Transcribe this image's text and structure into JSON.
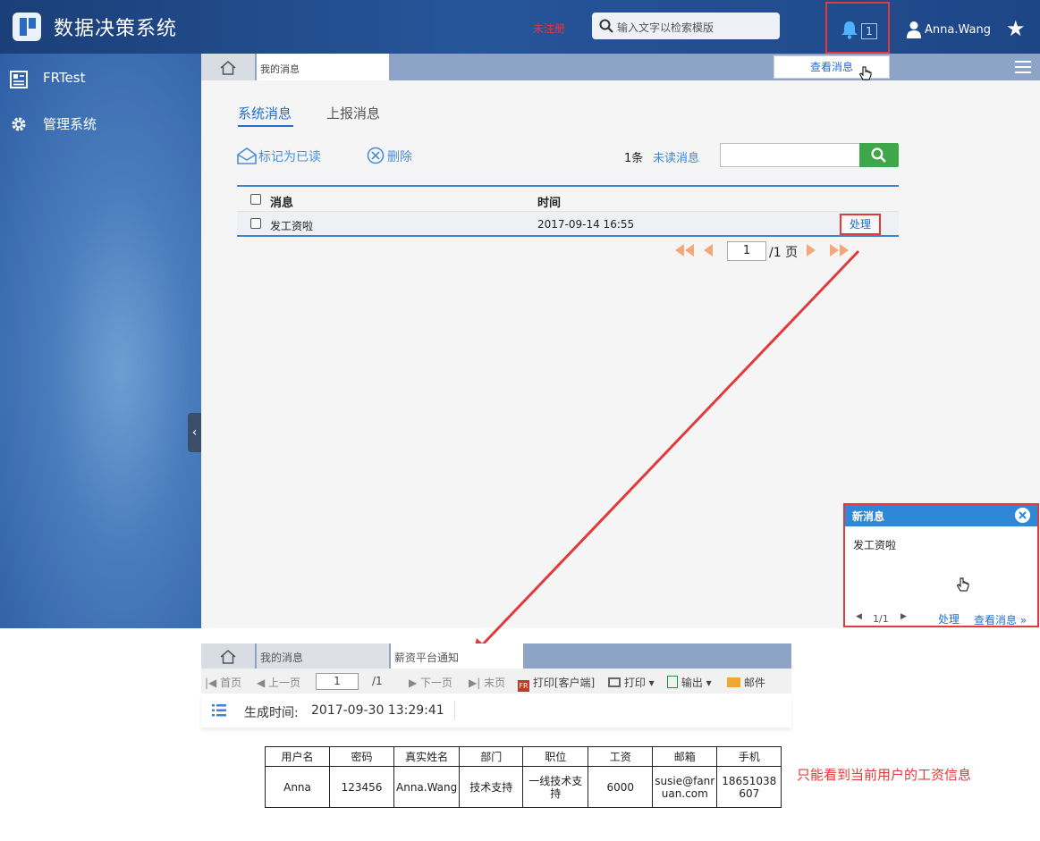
{
  "header": {
    "title": "数据决策系统",
    "unregistered": "未注册",
    "search_placeholder": "输入文字以检索模版",
    "notify_count": "1",
    "user": "Anna.Wang"
  },
  "sidebar": {
    "items": [
      {
        "label": "FRTest",
        "icon": "report-icon"
      },
      {
        "label": "管理系统",
        "icon": "gear-icon"
      }
    ]
  },
  "tabs": {
    "messages": "我的消息",
    "view_messages": "查看消息"
  },
  "messages": {
    "tab_system": "系统消息",
    "tab_report": "上报消息",
    "mark_read": "标记为已读",
    "delete": "删除",
    "count": "1条",
    "unread": "未读消息",
    "col_message": "消息",
    "col_time": "时间",
    "rows": [
      {
        "message": "发工资啦",
        "time": "2017-09-14 16:55",
        "action": "处理"
      }
    ],
    "pager": {
      "current": "1",
      "total": "/1 页"
    }
  },
  "notification": {
    "title": "新消息",
    "body": "发工资啦",
    "pager": "1/1",
    "process": "处理",
    "view": "查看消息 »"
  },
  "report": {
    "tabs": {
      "messages": "我的消息",
      "salary": "薪资平台通知"
    },
    "toolbar": {
      "first": "首页",
      "prev": "上一页",
      "page": "1",
      "total": "/1",
      "next": "下一页",
      "last": "末页",
      "print_client": "打印[客户端]",
      "print": "打印",
      "export": "输出",
      "mail": "邮件"
    },
    "generated_label": "生成时间:",
    "generated_value": "2017-09-30 13:29:41",
    "table": {
      "headers": [
        "用户名",
        "密码",
        "真实姓名",
        "部门",
        "职位",
        "工资",
        "邮箱",
        "手机"
      ],
      "row": [
        "Anna",
        "123456",
        "Anna.Wang",
        "技术支持",
        "一线技术支持",
        "6000",
        "susie@fanruan.com",
        "18651038607"
      ]
    }
  },
  "annotation": "只能看到当前用户的工资信息",
  "colors": {
    "accent": "#1e6fd0",
    "highlight": "#e23a3a",
    "header": "#27559a"
  }
}
